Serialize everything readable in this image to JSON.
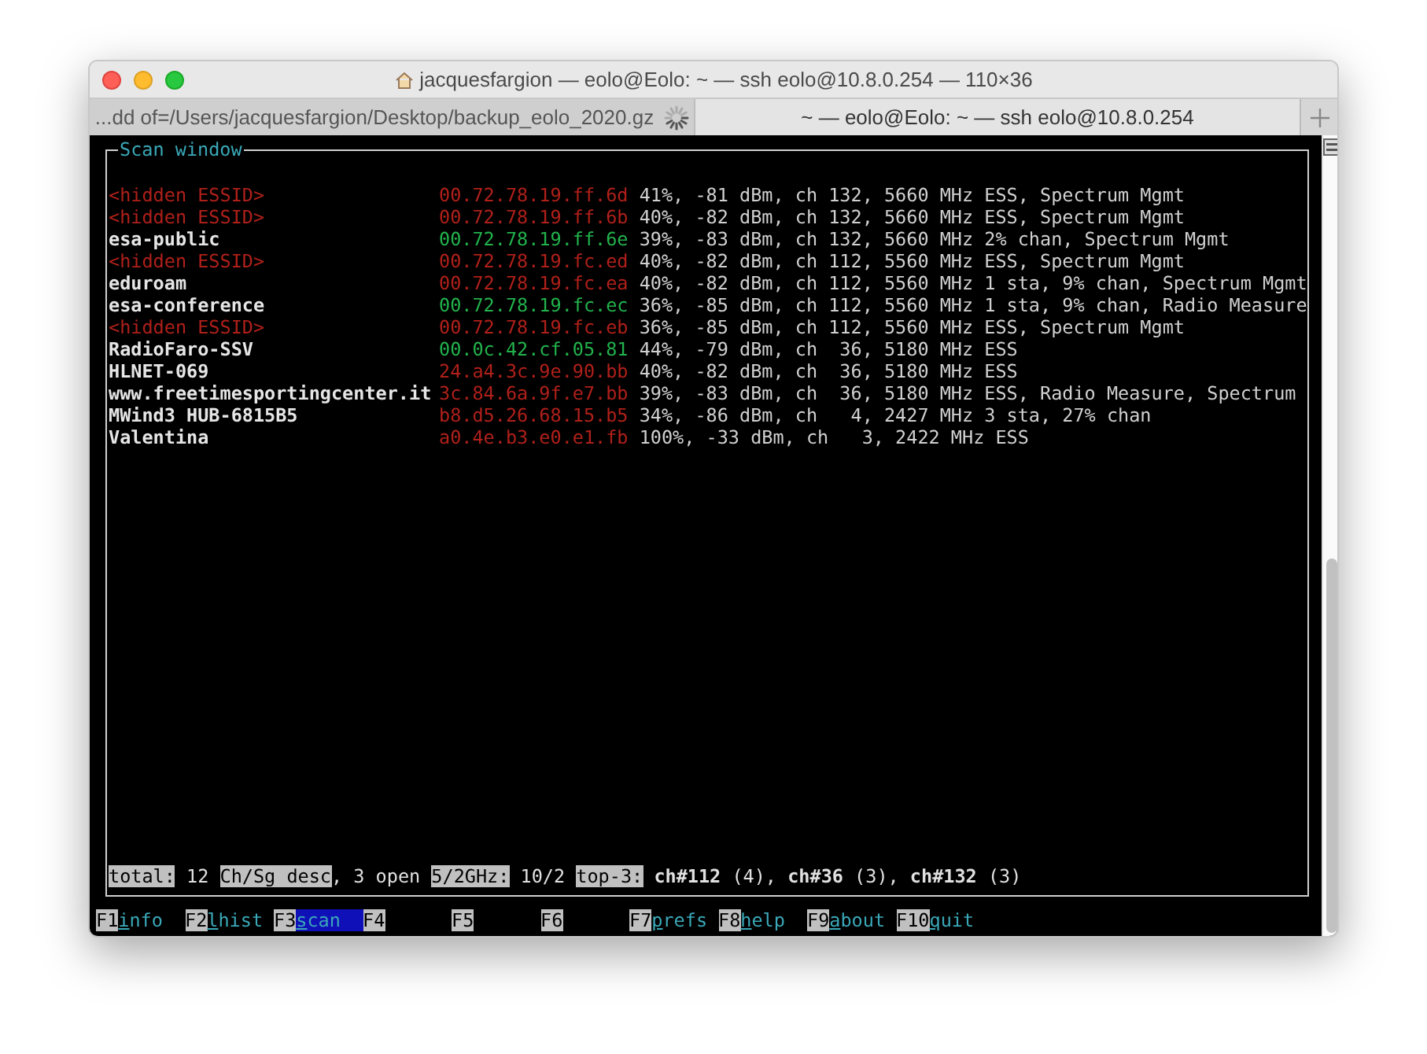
{
  "window": {
    "title": "jacquesfargion — eolo@Eolo: ~ — ssh eolo@10.8.0.254 — 110×36"
  },
  "tabs": [
    {
      "label": "...dd of=/Users/jacquesfargion/Desktop/backup_eolo_2020.gz",
      "selected": false,
      "busy": true
    },
    {
      "label": "~ — eolo@Eolo: ~ — ssh eolo@10.8.0.254",
      "selected": true,
      "busy": false
    }
  ],
  "scan_window": {
    "title": "Scan window",
    "rows": [
      {
        "essid": "<hidden ESSID>",
        "hidden": true,
        "bssid": "00.72.78.19.ff.6d",
        "encrypted": true,
        "info": " 41%, -81 dBm, ch 132, 5660 MHz ESS, Spectrum Mgmt"
      },
      {
        "essid": "<hidden ESSID>",
        "hidden": true,
        "bssid": "00.72.78.19.ff.6b",
        "encrypted": true,
        "info": " 40%, -82 dBm, ch 132, 5660 MHz ESS, Spectrum Mgmt"
      },
      {
        "essid": "esa-public",
        "hidden": false,
        "bssid": "00.72.78.19.ff.6e",
        "encrypted": false,
        "info": " 39%, -83 dBm, ch 132, 5660 MHz 2% chan, Spectrum Mgmt"
      },
      {
        "essid": "<hidden ESSID>",
        "hidden": true,
        "bssid": "00.72.78.19.fc.ed",
        "encrypted": true,
        "info": " 40%, -82 dBm, ch 112, 5560 MHz ESS, Spectrum Mgmt"
      },
      {
        "essid": "eduroam",
        "hidden": false,
        "bssid": "00.72.78.19.fc.ea",
        "encrypted": true,
        "info": " 40%, -82 dBm, ch 112, 5560 MHz 1 sta, 9% chan, Spectrum Mgmt"
      },
      {
        "essid": "esa-conference",
        "hidden": false,
        "bssid": "00.72.78.19.fc.ec",
        "encrypted": false,
        "info": " 36%, -85 dBm, ch 112, 5560 MHz 1 sta, 9% chan, Radio Measure"
      },
      {
        "essid": "<hidden ESSID>",
        "hidden": true,
        "bssid": "00.72.78.19.fc.eb",
        "encrypted": true,
        "info": " 36%, -85 dBm, ch 112, 5560 MHz ESS, Spectrum Mgmt"
      },
      {
        "essid": "RadioFaro-SSV",
        "hidden": false,
        "bssid": "00.0c.42.cf.05.81",
        "encrypted": false,
        "info": " 44%, -79 dBm, ch  36, 5180 MHz ESS"
      },
      {
        "essid": "HLNET-069",
        "hidden": false,
        "bssid": "24.a4.3c.9e.90.bb",
        "encrypted": true,
        "info": " 40%, -82 dBm, ch  36, 5180 MHz ESS"
      },
      {
        "essid": "www.freetimesportingcenter.it",
        "hidden": false,
        "bssid": "3c.84.6a.9f.e7.bb",
        "encrypted": true,
        "info": " 39%, -83 dBm, ch  36, 5180 MHz ESS, Radio Measure, Spectrum"
      },
      {
        "essid": "MWind3 HUB-6815B5",
        "hidden": false,
        "bssid": "b8.d5.26.68.15.b5",
        "encrypted": true,
        "info": " 34%, -86 dBm, ch   4, 2427 MHz 3 sta, 27% chan"
      },
      {
        "essid": "Valentina",
        "hidden": false,
        "bssid": "a0.4e.b3.e0.e1.fb",
        "encrypted": true,
        "info": " 100%, -33 dBm, ch   3, 2422 MHz ESS"
      }
    ],
    "status": [
      {
        "label": "total:",
        "text": " 12 "
      },
      {
        "label": "Ch/Sg desc",
        "text": ", 3 open "
      },
      {
        "label": "5/2GHz:",
        "text": " 10/2 "
      },
      {
        "label": "top-3:",
        "text": " **ch#112** (4), **ch#36** (3), **ch#132** (3)"
      }
    ]
  },
  "function_keys": [
    {
      "key": "F1",
      "label": "info",
      "selected": false
    },
    {
      "key": "F2",
      "label": "lhist",
      "selected": false
    },
    {
      "key": "F3",
      "label": "scan",
      "selected": true
    },
    {
      "key": "F4",
      "selected": false
    },
    {
      "key": "F5",
      "selected": false
    },
    {
      "key": "F6",
      "selected": false
    },
    {
      "key": "F7",
      "label": "prefs",
      "selected": false
    },
    {
      "key": "F8",
      "label": "help",
      "selected": false
    },
    {
      "key": "F9",
      "label": "about",
      "selected": false
    },
    {
      "key": "F10",
      "label": "quit",
      "selected": false
    }
  ]
}
